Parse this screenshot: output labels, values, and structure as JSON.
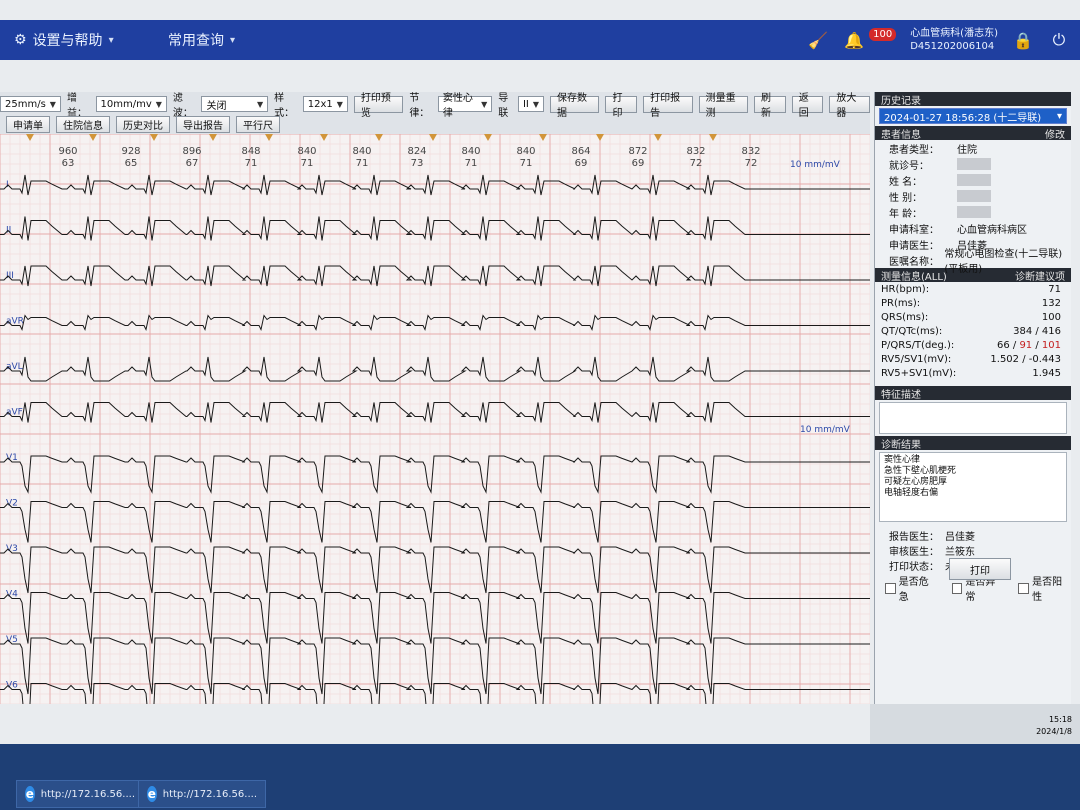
{
  "app": {
    "menu_settings": "设置与帮助",
    "menu_common": "常用查询",
    "badge_count": "100",
    "user_line1": "心血管病科(潘志东)",
    "user_line2": "D451202006104"
  },
  "toolbar": {
    "speed_label": "25mm/s",
    "gain_label": "增益：",
    "gain_value": "10mm/mv",
    "filter_label": "滤波：",
    "filter_value": "关闭",
    "style_label": "样式：",
    "style_value": "12x1",
    "print_btn1": "打印预览",
    "rhythm_label": "节律：",
    "rhythm_value": "窦性心律",
    "lead_label": "导联",
    "lead_value": "II",
    "btn_save": "保存数据",
    "btn_print": "打印",
    "btn_print_report": "打印报告",
    "btn_amp": "测量重测",
    "btn_refresh": "刷新",
    "btn_return": "返回",
    "btn_zoom": "放大器",
    "row2": [
      "申请单",
      "住院信息",
      "历史对比",
      "导出报告",
      "平行尺"
    ]
  },
  "ecg": {
    "rr_values": [
      "960",
      "928",
      "896",
      "848",
      "840",
      "840",
      "824",
      "840",
      "840",
      "864",
      "872",
      "832",
      "832"
    ],
    "hr_values": [
      "63",
      "65",
      "67",
      "71",
      "71",
      "71",
      "73",
      "71",
      "71",
      "69",
      "69",
      "72",
      "72"
    ],
    "lead_labels": [
      "I",
      "II",
      "III",
      "aVR",
      "aVL",
      "aVF",
      "V1",
      "V2",
      "V3",
      "V4",
      "V5",
      "V6"
    ],
    "calibration_labels": [
      "10 mm/mV",
      "10 mm/mV"
    ]
  },
  "panel": {
    "history_title": "历史记录",
    "history_value": "2024-01-27 18:56:28 (十二导联)",
    "basic_title": "患者信息",
    "basic_edit": "修改",
    "fields": [
      {
        "k": "患者类型：",
        "v": "住院"
      },
      {
        "k": "就诊号：",
        "v": ""
      },
      {
        "k": "姓    名：",
        "v": ""
      },
      {
        "k": "性    别：",
        "v": ""
      },
      {
        "k": "年    龄：",
        "v": ""
      },
      {
        "k": "申请科室：",
        "v": "心血管病科病区"
      },
      {
        "k": "申请医生：",
        "v": "吕佳菱"
      },
      {
        "k": "医嘱名称：",
        "v": "常规心电图检查(十二导联)(平板用)"
      }
    ],
    "measure_title": "测量信息(ALL)",
    "measure_right": "诊断建议项",
    "measures": [
      {
        "k": "HR(bpm):",
        "v": "71"
      },
      {
        "k": "PR(ms):",
        "v": "132"
      },
      {
        "k": "QRS(ms):",
        "v": "100"
      },
      {
        "k": "QT/QTc(ms):",
        "v": "384 / 416"
      },
      {
        "k": "P/QRS/T(deg.):",
        "v": "66 / 91 / 101"
      },
      {
        "k": "RV5/SV1(mV):",
        "v": "1.502 / -0.443"
      },
      {
        "k": "RV5+SV1(mV):",
        "v": "1.945"
      }
    ],
    "feature_title": "特征描述",
    "diag_title": "诊断结果",
    "diagnosis": [
      "窦性心律",
      "急性下壁心肌梗死",
      "可疑左心房肥厚",
      "电轴轻度右偏"
    ],
    "doctors": [
      {
        "k": "报告医生：",
        "v": "吕佳菱"
      },
      {
        "k": "审核医生：",
        "v": "兰筱东"
      },
      {
        "k": "打印状态：",
        "v": "未打印"
      }
    ],
    "checks": [
      "是否危急",
      "是否异常",
      "是否阳性"
    ],
    "print_label": "打印"
  },
  "tray": {
    "time": "15:18",
    "date": "2024/1/8"
  },
  "taskbar": {
    "item1": "http://172.16.56....",
    "item2": "http://172.16.56...."
  }
}
